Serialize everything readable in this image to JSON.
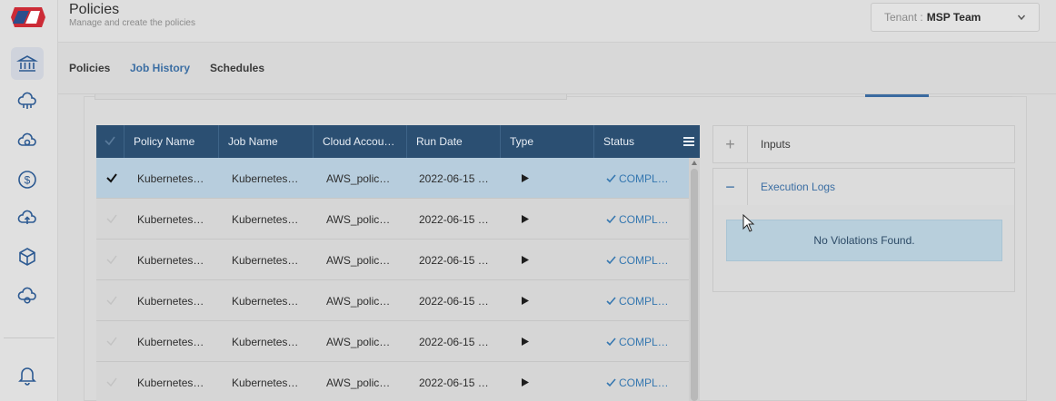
{
  "header": {
    "title": "Policies",
    "subtitle": "Manage and create the policies",
    "tenant_label": "Tenant :",
    "tenant_value": "MSP Team"
  },
  "tabs": [
    {
      "label": "Policies",
      "active": false
    },
    {
      "label": "Job History",
      "active": true
    },
    {
      "label": "Schedules",
      "active": false
    }
  ],
  "sidebar": {
    "items": [
      {
        "icon": "bank-icon",
        "active": true
      },
      {
        "icon": "cloud-network-icon",
        "active": false
      },
      {
        "icon": "cloud-sync-icon",
        "active": false
      },
      {
        "icon": "dollar-icon",
        "active": false
      },
      {
        "icon": "cloud-upload-icon",
        "active": false
      },
      {
        "icon": "cube-icon",
        "active": false
      },
      {
        "icon": "cloud-gear-icon",
        "active": false
      }
    ],
    "bottom_icon": "bell-icon"
  },
  "grid": {
    "columns": [
      "Policy Name",
      "Job Name",
      "Cloud Accou…",
      "Run Date",
      "Type",
      "Status"
    ],
    "rows": [
      {
        "policy": "Kubernetes…",
        "job": "Kubernetes…",
        "account": "AWS_polic…",
        "date": "2022-06-15 …",
        "status": "COMPL…",
        "selected": true
      },
      {
        "policy": "Kubernetes…",
        "job": "Kubernetes…",
        "account": "AWS_polic…",
        "date": "2022-06-15 …",
        "status": "COMPL…",
        "selected": false
      },
      {
        "policy": "Kubernetes…",
        "job": "Kubernetes…",
        "account": "AWS_polic…",
        "date": "2022-06-15 …",
        "status": "COMPL…",
        "selected": false
      },
      {
        "policy": "Kubernetes…",
        "job": "Kubernetes…",
        "account": "AWS_polic…",
        "date": "2022-06-15 …",
        "status": "COMPL…",
        "selected": false
      },
      {
        "policy": "Kubernetes…",
        "job": "Kubernetes…",
        "account": "AWS_polic…",
        "date": "2022-06-15 …",
        "status": "COMPL…",
        "selected": false
      },
      {
        "policy": "Kubernetes…",
        "job": "Kubernetes…",
        "account": "AWS_polic…",
        "date": "2022-06-15 …",
        "status": "COMPL…",
        "selected": false
      }
    ]
  },
  "panel": {
    "inputs_sign": "+",
    "inputs_title": "Inputs",
    "logs_sign": "−",
    "logs_title": "Execution Logs",
    "logs_message": "No Violations Found."
  },
  "colors": {
    "accent": "#3b6ea3",
    "grid_header": "#2b4f72",
    "selected_row": "#b7cddd",
    "status": "#3577b0"
  }
}
